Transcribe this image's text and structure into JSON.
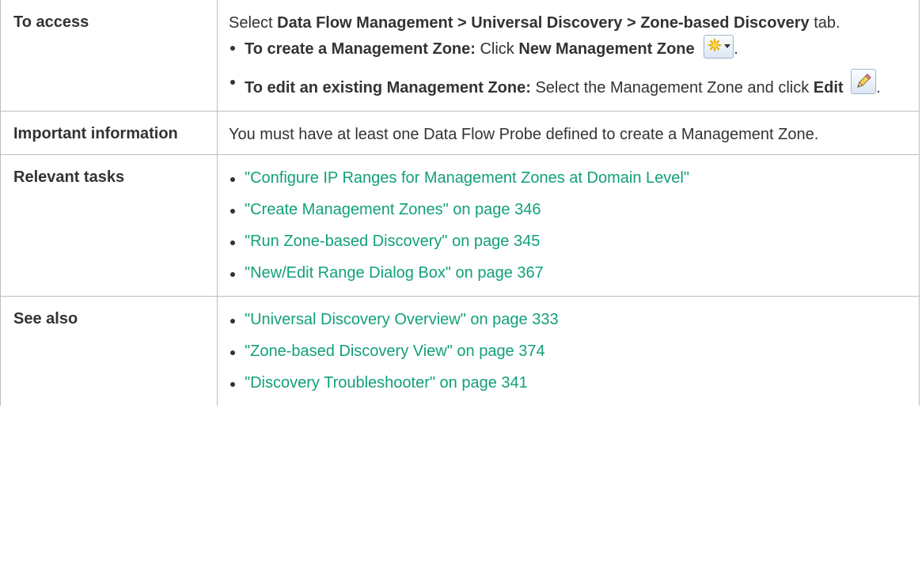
{
  "rows": {
    "access": {
      "label": "To access",
      "intro_prefix": "Select ",
      "intro_path": "Data Flow Management > Universal Discovery > Zone-based Discovery",
      "intro_suffix": " tab.",
      "create": {
        "lead": "To create a Management Zone:",
        "text": " Click ",
        "action": "New Management Zone",
        "icon": "new-management-zone-icon",
        "end": "."
      },
      "edit": {
        "lead": "To edit an existing Management Zone:",
        "text": " Select the Management Zone and click ",
        "action": "Edit",
        "icon": "edit-pencil-icon",
        "end": "."
      }
    },
    "important": {
      "label": "Important information",
      "text": "You must have at least one Data Flow Probe defined to create a Management Zone."
    },
    "tasks": {
      "label": "Relevant tasks",
      "links": [
        "\"Configure IP Ranges for Management Zones at Domain Level\"",
        "\"Create Management Zones\" on page 346",
        "\"Run Zone-based Discovery\" on page 345",
        "\"New/Edit Range Dialog Box\" on page 367"
      ]
    },
    "see_also": {
      "label": "See also",
      "links": [
        "\"Universal Discovery Overview\" on page 333",
        "\"Zone-based Discovery View\" on page 374",
        "\"Discovery Troubleshooter\" on page 341"
      ]
    }
  },
  "colors": {
    "link": "#12a07a",
    "text": "#333333",
    "border": "#bdbdbd"
  }
}
